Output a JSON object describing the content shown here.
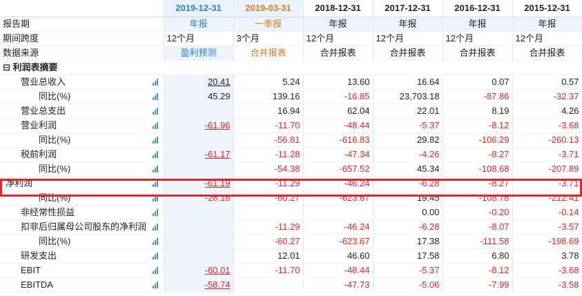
{
  "header": {
    "periods": [
      "2019-12-31",
      "2019-03-31",
      "2018-12-31",
      "2017-12-31",
      "2016-12-31",
      "2015-12-31"
    ]
  },
  "meta_rows": {
    "report_label": "报告期",
    "report_values": [
      "年报",
      "一季报",
      "年报",
      "年报",
      "年报",
      "年报"
    ],
    "span_label": "期间跨度",
    "span_values": [
      "12个月",
      "3个月",
      "12个月",
      "12个月",
      "12个月",
      "12个月"
    ],
    "source_label": "数据来源",
    "source_values": [
      "盈利预测",
      "合并报表",
      "合并报表",
      "合并报表",
      "合并报表",
      "合并报表"
    ]
  },
  "section": {
    "toggle": "⊟",
    "title": "利润表摘要"
  },
  "rows": [
    {
      "label": "营业总收入",
      "values": [
        "20.41",
        "5.24",
        "13.60",
        "16.64",
        "0.07",
        "0.57"
      ]
    },
    {
      "label": "同比(%)",
      "values": [
        "45.29",
        "139.16",
        "-16.85",
        "23,703.18",
        "-87.86",
        "-32.37"
      ]
    },
    {
      "label": "营业总支出",
      "values": [
        "",
        "16.94",
        "62.04",
        "22.01",
        "8.19",
        "4.26"
      ]
    },
    {
      "label": "营业利润",
      "values": [
        "-61.96",
        "-11.70",
        "-48.44",
        "-5.37",
        "-8.12",
        "-3.68"
      ]
    },
    {
      "label": "同比(%)",
      "values": [
        "",
        "-56.81",
        "-616.83",
        "29.82",
        "-106.29",
        "-260.13"
      ]
    },
    {
      "label": "税前利润",
      "values": [
        "-61.17",
        "-11.28",
        "-47.34",
        "-4.26",
        "-8.27",
        "-3.71"
      ]
    },
    {
      "label": "同比(%)",
      "values": [
        "",
        "-54.38",
        "-657.52",
        "45.34",
        "-108.68",
        "-207.89"
      ]
    },
    {
      "label": "净利润",
      "values": [
        "-61.19",
        "-11.29",
        "-46.24",
        "-6.28",
        "-8.27",
        "-3.71"
      ]
    },
    {
      "label": "同比(%)",
      "values": [
        "-28.18",
        "-60.27",
        "-623.67",
        "19.45",
        "-108.78",
        "-212.41"
      ]
    },
    {
      "label": "非经常性损益",
      "values": [
        "",
        "",
        "",
        "0.00",
        "-0.20",
        "-0.14"
      ]
    },
    {
      "label": "扣非后归属母公司股东的净利润",
      "values": [
        "",
        "-11.29",
        "-46.24",
        "-6.28",
        "-8.07",
        "-3.57"
      ]
    },
    {
      "label": "同比(%)",
      "values": [
        "",
        "-60.27",
        "-623.67",
        "17.38",
        "-111.58",
        "-198.69"
      ]
    },
    {
      "label": "研发支出",
      "values": [
        "",
        "12.01",
        "46.60",
        "17.58",
        "6.80",
        "3.78"
      ]
    },
    {
      "label": "EBIT",
      "values": [
        "-60.01",
        "-11.70",
        "-48.44",
        "-5.37",
        "-8.12",
        "-3.68"
      ]
    },
    {
      "label": "EBITDA",
      "values": [
        "-58.74",
        "",
        "-47.73",
        "-5.06",
        "-7.99",
        "-3.58"
      ]
    }
  ],
  "colors": {
    "accent_blue": "#2a7fc7",
    "accent_orange": "#e07b1f",
    "negative": "#e22222",
    "highlight_box": "#e0262b"
  }
}
